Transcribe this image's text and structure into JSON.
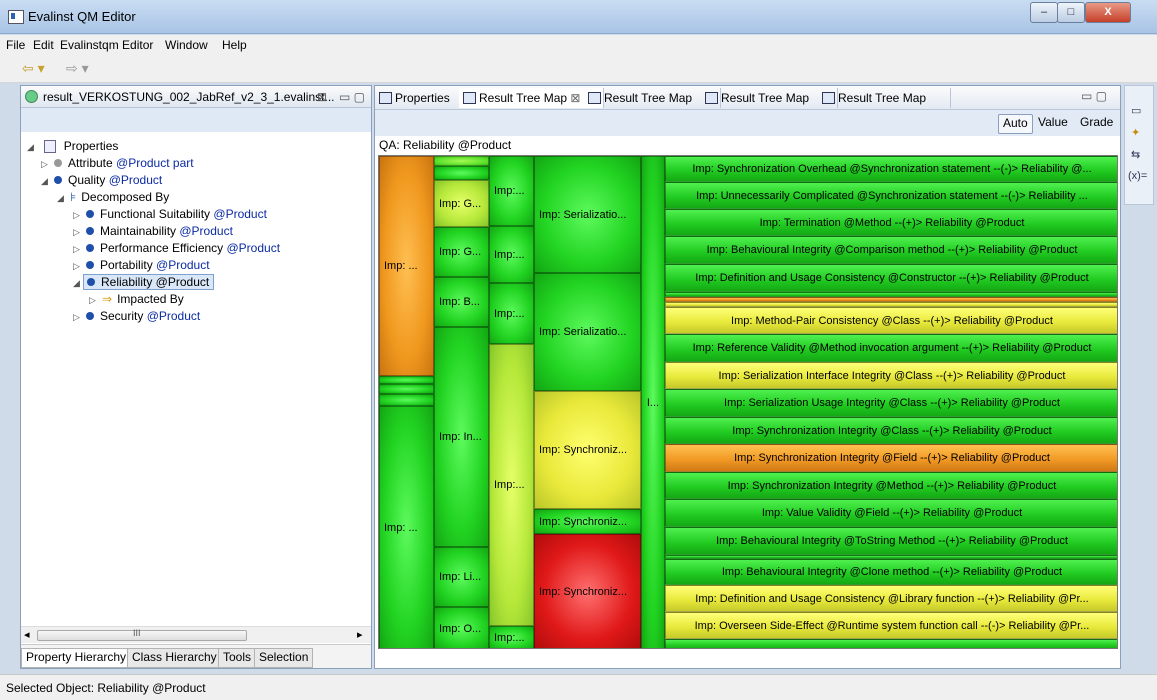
{
  "window": {
    "title": "Evalinst QM Editor",
    "minimize": "–",
    "maximize": "□",
    "close": "X"
  },
  "menu": [
    "File",
    "Edit",
    "Evalinstqm Editor",
    "Window",
    "Help"
  ],
  "toolbar": {
    "back": "⇦ ▾",
    "forward": "⇨ ▾"
  },
  "left": {
    "tab_title": "result_VERKOSTUNG_002_JabRef_v2_3_1.evalinst...",
    "tab_close": "⊠",
    "min_max": "▭ ▢",
    "tree": {
      "properties": "Properties",
      "attribute_prefix": "Attribute ",
      "attribute_link": "@Product part",
      "quality_prefix": "Quality ",
      "quality_link": "@Product",
      "decomposed": "Decomposed By",
      "functional_prefix": "Functional Suitability ",
      "maintain_prefix": "Maintainability ",
      "performance_prefix": "Performance Efficiency ",
      "portability_prefix": "Portability ",
      "reliability": "Reliability @Product",
      "impacted": "Impacted By",
      "security_prefix": "Security ",
      "product_link": "@Product"
    },
    "scroll_left": "◂",
    "scroll_right": "▸",
    "scroll_grip": "III",
    "bottom_tabs": [
      "Property Hierarchy",
      "Class Hierarchy",
      "Tools",
      "Selection"
    ]
  },
  "right": {
    "tabs": [
      "Properties",
      "Result Tree Map",
      "Result Tree Map",
      "Result Tree Map",
      "Result Tree Map"
    ],
    "tab_close": "⊠",
    "min_max": "▭ ▢",
    "modes": [
      "Auto",
      "Value",
      "Grade"
    ],
    "qa_label": "QA: Reliability @Product",
    "treemap": {
      "col1": [
        "Imp: ...",
        "Imp: ..."
      ],
      "col2": [
        "Imp: G...",
        "Imp: G...",
        "Imp: B...",
        "Imp: In...",
        "Imp: Li...",
        "Imp: O..."
      ],
      "col3": [
        "Imp:...",
        "Imp:...",
        "Imp:...",
        "Imp:...",
        "Imp:..."
      ],
      "col4": [
        "Imp: Serializatio...",
        "Imp: Serializatio...",
        "Imp: Synchroniz...",
        "Imp: Synchroniz...",
        "Imp: Synchroniz..."
      ],
      "col5": "I...",
      "rows": [
        "Imp: Synchronization Overhead @Synchronization statement --(-)> Reliability @...",
        "Imp: Unnecessarily Complicated @Synchronization statement --(-)> Reliability ...",
        "Imp: Termination @Method --(+)> Reliability @Product",
        "Imp: Behavioural Integrity @Comparison method --(+)> Reliability @Product",
        "Imp: Definition and Usage Consistency @Constructor --(+)> Reliability @Product",
        "Imp: Method-Pair Consistency  @Class --(+)> Reliability @Product",
        "Imp: Reference Validity @Method invocation argument --(+)> Reliability @Product",
        "Imp: Serialization Interface Integrity @Class --(+)> Reliability @Product",
        "Imp: Serialization Usage Integrity @Class --(+)> Reliability @Product",
        "Imp: Synchronization Integrity @Class --(+)> Reliability @Product",
        "Imp: Synchronization Integrity @Field --(+)> Reliability @Product",
        "Imp: Synchronization Integrity @Method --(+)> Reliability @Product",
        "Imp: Value Validity @Field --(+)> Reliability @Product",
        "Imp: Behavioural Integrity @ToString Method --(+)> Reliability @Product",
        "Imp: Behavioural Integrity @Clone method --(+)> Reliability @Product",
        "Imp: Definition and Usage Consistency @Library function --(+)> Reliability @Pr...",
        "Imp: Overseen Side-Effect @Runtime system function call --(-)> Reliability @Pr..."
      ]
    }
  },
  "side_icons": [
    "▭",
    "✦",
    "⇆",
    "(x)="
  ],
  "status": "Selected Object: Reliability @Product"
}
